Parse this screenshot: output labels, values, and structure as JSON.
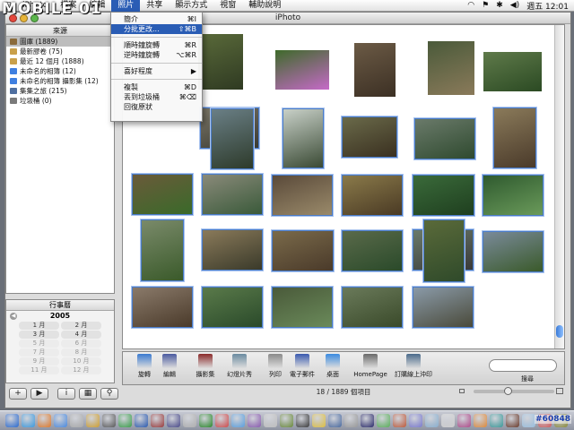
{
  "watermark": "MOBILE 01",
  "menubar": {
    "items": [
      "iPhoto",
      "檔案",
      "編輯",
      "照片",
      "共享",
      "顯示方式",
      "視窗",
      "輔助說明"
    ],
    "clock": "週五 12:01"
  },
  "window": {
    "title": "iPhoto"
  },
  "dropdown": {
    "items": [
      {
        "label": "簡介",
        "shortcut": "⌘I"
      },
      {
        "label": "分批更改...",
        "shortcut": "⇧⌘B"
      },
      {
        "label": "順時鐘旋轉",
        "shortcut": "⌘R"
      },
      {
        "label": "逆時鐘旋轉",
        "shortcut": "⌥⌘R"
      },
      {
        "label": "喜好程度",
        "shortcut": "▶"
      },
      {
        "label": "複製",
        "shortcut": "⌘D"
      },
      {
        "label": "丟到垃圾桶",
        "shortcut": "⌘⌫"
      },
      {
        "label": "回復原狀",
        "shortcut": ""
      }
    ]
  },
  "sidebar": {
    "header": "來源",
    "items": [
      {
        "label": "圖庫 (1889)",
        "color": "#8a6a3a"
      },
      {
        "label": "最新膠卷 (75)",
        "color": "#c9a04a"
      },
      {
        "label": "最近 12 個月 (1888)",
        "color": "#c9a04a"
      },
      {
        "label": "未命名的相簿 (12)",
        "color": "#3f7fe0"
      },
      {
        "label": "未命名的相簿 攝影集 (12)",
        "color": "#3f7fe0"
      },
      {
        "label": "集集之旅 (215)",
        "color": "#4f6fa0"
      },
      {
        "label": "垃圾桶 (0)",
        "color": "#7a7a7a"
      }
    ]
  },
  "calendar": {
    "header": "行事曆",
    "year": "2005",
    "months": [
      "1 月",
      "2 月",
      "3 月",
      "4 月",
      "5 月",
      "6 月",
      "7 月",
      "8 月",
      "9 月",
      "10 月",
      "11 月",
      "12 月"
    ]
  },
  "toolbar": {
    "buttons": [
      "旋轉",
      "編輯",
      "攝影集",
      "幻燈片秀",
      "列印",
      "電子郵件",
      "桌面",
      "HomePage",
      "訂購線上沖印"
    ],
    "search_label": "搜尋"
  },
  "status": {
    "text": "18 / 1889 個項目"
  },
  "dock_tag": "#60848"
}
